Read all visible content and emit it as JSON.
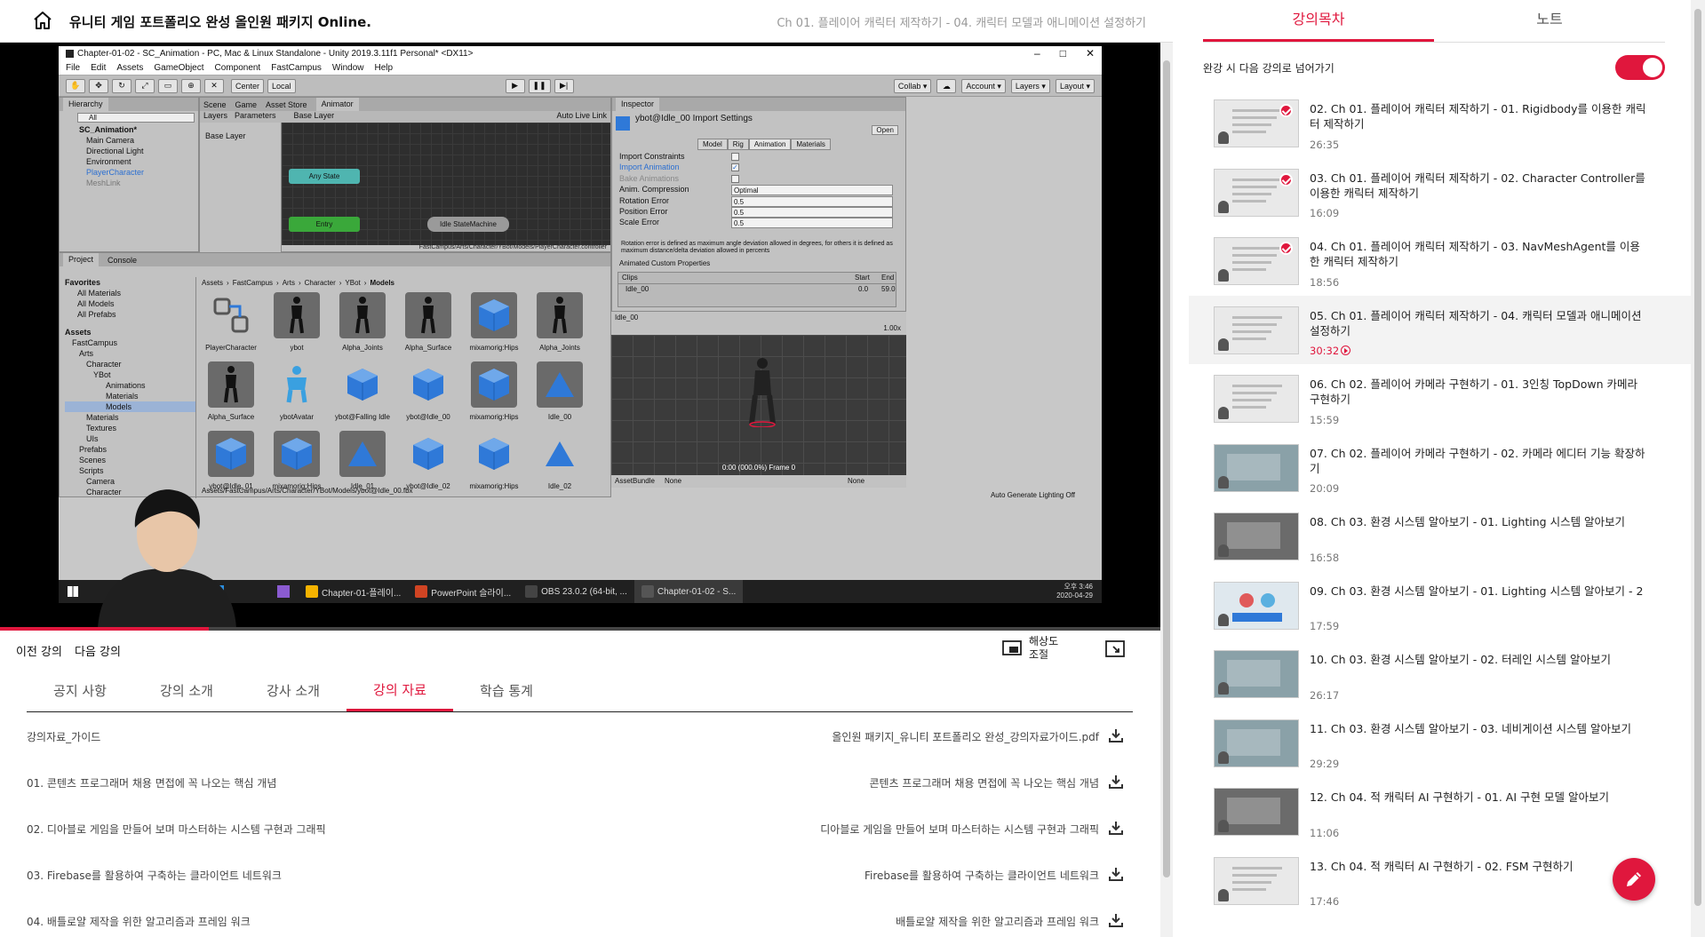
{
  "header": {
    "course_title": "유니티 게임 포트폴리오 완성 올인원 패키지 Online.",
    "lecture_crumb": "Ch 01. 플레이어 캐릭터 제작하기 - 04. 캐릭터 모델과 애니메이션 설정하기"
  },
  "video": {
    "progress": 0.18,
    "unity": {
      "window_title": "Chapter-01-02 - SC_Animation - PC, Mac & Linux Standalone - Unity 2019.3.11f1 Personal* <DX11>",
      "menu": [
        "File",
        "Edit",
        "Assets",
        "GameObject",
        "Component",
        "FastCampus",
        "Window",
        "Help"
      ],
      "toolbar_left": [
        "Center",
        "Local"
      ],
      "toolbar_right": [
        "Collab ▾",
        "Account ▾",
        "Layers ▾",
        "Layout ▾"
      ],
      "hierarchy_tab": "Hierarchy",
      "hierarchy_search": "All",
      "hierarchy_items": [
        "SC_Animation*",
        "Main Camera",
        "Directional Light",
        "Environment",
        "PlayerCharacter",
        "MeshLink"
      ],
      "center_tabs": [
        "Scene",
        "Game",
        "Asset Store",
        "Animator"
      ],
      "animator_subtabs": [
        "Layers",
        "Parameters"
      ],
      "animator_breadcrumb": "Base Layer",
      "auto_live_link": "Auto Live Link",
      "base_layer": "Base Layer",
      "states": {
        "any": "Any State",
        "entry": "Entry",
        "sub": "Idle StateMachine"
      },
      "animator_path": "FastCampus/Arts/Character/YBot/Models/PlayerCharacter.controller",
      "project_tabs": [
        "Project",
        "Console"
      ],
      "favorites": [
        "Favorites",
        "All Materials",
        "All Models",
        "All Prefabs"
      ],
      "assets_tree": [
        "Assets",
        "FastCampus",
        "Arts",
        "Character",
        "YBot",
        "Animations",
        "Materials",
        "Models",
        "Materials",
        "Textures",
        "UIs",
        "Prefabs",
        "Scenes",
        "Scripts",
        "Camera",
        "Character",
        "Environ",
        "UIs",
        "Packages"
      ],
      "project_breadcrumb": [
        "Assets",
        "FastCampus",
        "Arts",
        "Character",
        "YBot",
        "Models"
      ],
      "assets": [
        "PlayerCharacter",
        "ybot",
        "Alpha_Joints",
        "Alpha_Surface",
        "mixamorig:Hips",
        "Alpha_Joints",
        "Alpha_Surface",
        "ybotAvatar",
        "ybot@Falling Idle",
        "ybot@Idle_00",
        "mixamorig:Hips",
        "Idle_00",
        "ybot@Idle_01",
        "mixamorig:Hips",
        "Idle_01",
        "ybot@Idle_02",
        "mixamorig:Hips",
        "Idle_02"
      ],
      "asset_path": "Assets/FastCampus/Arts/Character/YBot/Models/ybot@Idle_00.fbx",
      "inspector_tab": "Inspector",
      "inspector_title": "ybot@Idle_00 Import Settings",
      "open_btn": "Open",
      "import_tabs": [
        "Model",
        "Rig",
        "Animation",
        "Materials"
      ],
      "import_rows": [
        {
          "label": "Import Constraints",
          "value": ""
        },
        {
          "label": "Import Animation",
          "value": ""
        },
        {
          "label": "Bake Animations",
          "value": ""
        },
        {
          "label": "Anim. Compression",
          "value": "Optimal"
        },
        {
          "label": "Rotation Error",
          "value": "0.5"
        },
        {
          "label": "Position Error",
          "value": "0.5"
        },
        {
          "label": "Scale Error",
          "value": "0.5"
        }
      ],
      "rotation_note": "Rotation error is defined as maximum angle deviation allowed in degrees, for others it is defined as maximum distance/delta deviation allowed in percents",
      "animated_custom": "Animated Custom Properties",
      "clips_header": {
        "clips": "Clips",
        "start": "Start",
        "end": "End"
      },
      "clip": {
        "name": "Idle_00",
        "start": "0.0",
        "end": "59.0"
      },
      "preview_name": "Idle_00",
      "preview_speed": "1.00x",
      "preview_frame": "0:00 (000.0%) Frame 0",
      "assetbundle_label": "AssetBundle",
      "assetbundle_value": "None",
      "assetbundle_variant": "None",
      "lighting_status": "Auto Generate Lighting Off",
      "taskbar": [
        "Chapter-01-플레이...",
        "PowerPoint 슬라이...",
        "OBS 23.0.2 (64-bit, ...",
        "Chapter-01-02 - S..."
      ],
      "clock_time": "오후 3:46",
      "clock_date": "2020-04-29"
    }
  },
  "controls": {
    "prev": "이전 강의",
    "next": "다음 강의",
    "resolution": "해상도\n조절"
  },
  "tabs": [
    "공지 사항",
    "강의 소개",
    "강사 소개",
    "강의 자료",
    "학습 통계"
  ],
  "active_tab_index": 3,
  "materials": [
    {
      "left": "강의자료_가이드",
      "right": "올인원 패키지_유니티 포트폴리오 완성_강의자료가이드.pdf"
    },
    {
      "left": "01. 콘텐츠 프로그래머 채용 면접에 꼭 나오는 핵심 개념",
      "right": "콘텐츠 프로그래머 채용 면접에 꼭 나오는 핵심 개념"
    },
    {
      "left": "02. 디아블로 게임을 만들어 보며 마스터하는 시스템 구현과 그래픽",
      "right": "디아블로 게임을 만들어 보며 마스터하는 시스템 구현과 그래픽"
    },
    {
      "left": "03. Firebase를 활용하여 구축하는 클라이언트 네트워크",
      "right": "Firebase를 활용하여 구축하는 클라이언트 네트워크"
    },
    {
      "left": "04. 배틀로얄 제작을 위한 알고리즘과 프레임 워크",
      "right": "배틀로얄 제작을 위한 알고리즘과 프레임 워크"
    }
  ],
  "sidebar": {
    "tabs": [
      "강의목차",
      "노트"
    ],
    "auto_next_label": "완강 시 다음 강의로 넘어가기",
    "auto_next_on": true,
    "lectures": [
      {
        "title": "02. Ch 01. 플레이어 캐릭터 제작하기 - 01. Rigidbody를 이용한 캐릭터 제작하기",
        "duration": "26:35",
        "done": true,
        "current": false,
        "thumb": "slide"
      },
      {
        "title": "03. Ch 01. 플레이어 캐릭터 제작하기 - 02. Character Controller를 이용한 캐릭터 제작하기",
        "duration": "16:09",
        "done": true,
        "current": false,
        "thumb": "slide"
      },
      {
        "title": "04. Ch 01. 플레이어 캐릭터 제작하기 - 03. NavMeshAgent를 이용한 캐릭터 제작하기",
        "duration": "18:56",
        "done": true,
        "current": false,
        "thumb": "slide"
      },
      {
        "title": "05. Ch 01. 플레이어 캐릭터 제작하기 - 04. 캐릭터 모델과 애니메이션 설정하기",
        "duration": "30:32",
        "done": false,
        "current": true,
        "thumb": "slide"
      },
      {
        "title": "06. Ch 02. 플레이어 카메라 구현하기 - 01. 3인칭 TopDown 카메라 구현하기",
        "duration": "15:59",
        "done": false,
        "current": false,
        "thumb": "slide"
      },
      {
        "title": "07. Ch 02. 플레이어 카메라 구현하기 - 02. 카메라 에디터 기능 확장하기",
        "duration": "20:09",
        "done": false,
        "current": false,
        "thumb": "editor"
      },
      {
        "title": "08. Ch 03. 환경 시스템 알아보기 - 01. Lighting 시스템 알아보기",
        "duration": "16:58",
        "done": false,
        "current": false,
        "thumb": "dark"
      },
      {
        "title": "09. Ch 03. 환경 시스템 알아보기 - 01. Lighting 시스템 알아보기 - 2",
        "duration": "17:59",
        "done": false,
        "current": false,
        "thumb": "probes"
      },
      {
        "title": "10. Ch 03. 환경 시스템 알아보기 - 02. 터레인 시스템 알아보기",
        "duration": "26:17",
        "done": false,
        "current": false,
        "thumb": "scene"
      },
      {
        "title": "11. Ch 03. 환경 시스템 알아보기 - 03. 네비게이션 시스템 알아보기",
        "duration": "29:29",
        "done": false,
        "current": false,
        "thumb": "scene"
      },
      {
        "title": "12. Ch 04. 적 캐릭터 AI 구현하기 - 01. AI 구현 모델 알아보기",
        "duration": "11:06",
        "done": false,
        "current": false,
        "thumb": "dark"
      },
      {
        "title": "13. Ch 04. 적 캐릭터 AI 구현하기 - 02. FSM 구현하기",
        "duration": "17:46",
        "done": false,
        "current": false,
        "thumb": "slide"
      }
    ]
  },
  "colors": {
    "accent": "#e0173d"
  }
}
